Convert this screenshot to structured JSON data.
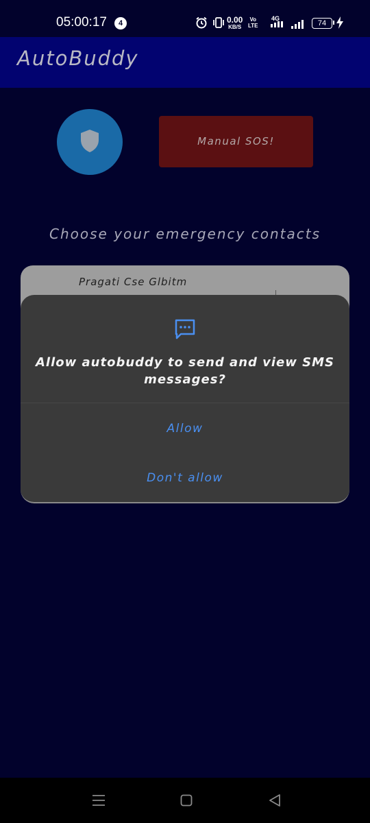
{
  "status_bar": {
    "time": "05:00:17",
    "notification_count": "4",
    "net_speed_value": "0.00",
    "net_speed_unit": "KB/S",
    "volte_top": "Vo",
    "volte_bottom": "LTE",
    "signal_label": "4G",
    "battery_level": "74",
    "icons": [
      "alarm-icon",
      "vibrate-icon",
      "signal-4g-icon",
      "signal-bars-icon",
      "battery-icon",
      "charging-bolt-icon"
    ]
  },
  "app_bar": {
    "title": "AutoBuddy"
  },
  "main": {
    "shield_icon": "shield-icon",
    "sos_label": "Manual SOS!",
    "contacts_heading": "Choose your emergency contacts",
    "contacts": [
      {
        "name": "Pragati Cse Glbitm"
      }
    ]
  },
  "dialog": {
    "icon": "sms-icon",
    "message": "Allow autobuddy to send and view SMS messages?",
    "allow_label": "Allow",
    "deny_label": "Don't allow"
  },
  "nav_bar": {
    "icons": [
      "menu-icon",
      "home-icon",
      "back-icon"
    ]
  },
  "colors": {
    "background": "#02022c",
    "app_bar": "#020370",
    "shield_button": "#1a6aa7",
    "sos_button": "#5b1012",
    "dialog": "#3a3a3a",
    "dialog_action": "#4a8ff0"
  }
}
